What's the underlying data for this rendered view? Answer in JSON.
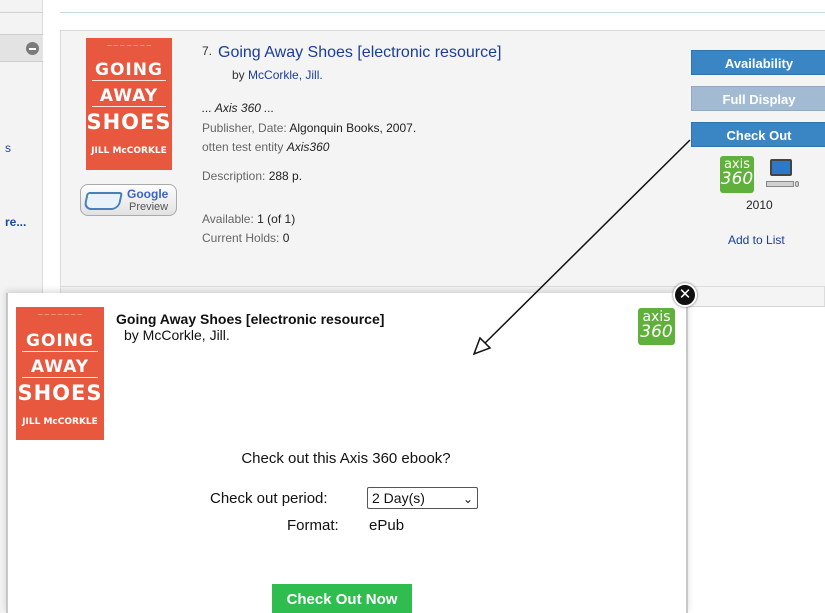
{
  "sidebar": {
    "fragment_1": "s",
    "fragment_2": "re..."
  },
  "record": {
    "number": "7.",
    "title": "Going Away Shoes [electronic resource]",
    "by_prefix": "by",
    "author": "McCorkle, Jill.",
    "axis_note": "... Axis 360 ...",
    "publisher_label": "Publisher, Date:",
    "publisher_value": "Algonquin Books, 2007.",
    "entity_label": "otten test entity",
    "entity_value": "Axis360",
    "description_label": "Description:",
    "description_value": "288 p.",
    "available_label": "Available:",
    "available_value": "1 (of 1)",
    "holds_label": "Current Holds:",
    "holds_value": "0"
  },
  "cover": {
    "line1": "GOING",
    "line2": "AWAY",
    "line3": "SHOES",
    "author": "JILL McCORKLE"
  },
  "google_preview": {
    "brand": "Google",
    "label": "Preview"
  },
  "actions": {
    "availability": "Availability",
    "full_display": "Full Display",
    "check_out": "Check Out",
    "year": "2010",
    "add_to_list": "Add to List"
  },
  "axis_logo": {
    "line1": "axis",
    "line2": "360"
  },
  "modal": {
    "title": "Going Away Shoes [electronic resource]",
    "author": "by McCorkle, Jill.",
    "close_symbol": "✕",
    "question": "Check out this Axis 360 ebook?",
    "period_label": "Check out period:",
    "period_value": "2 Day(s)",
    "format_label": "Format:",
    "format_value": "ePub",
    "check_out_now": "Check Out Now"
  },
  "colors": {
    "action_blue": "#3a86c4",
    "action_disabled": "#a2bbd2",
    "axis_green": "#5fb13b",
    "checkout_green": "#2fbd4f",
    "cover_orange": "#e8583f",
    "link_blue": "#1a3d9a"
  }
}
